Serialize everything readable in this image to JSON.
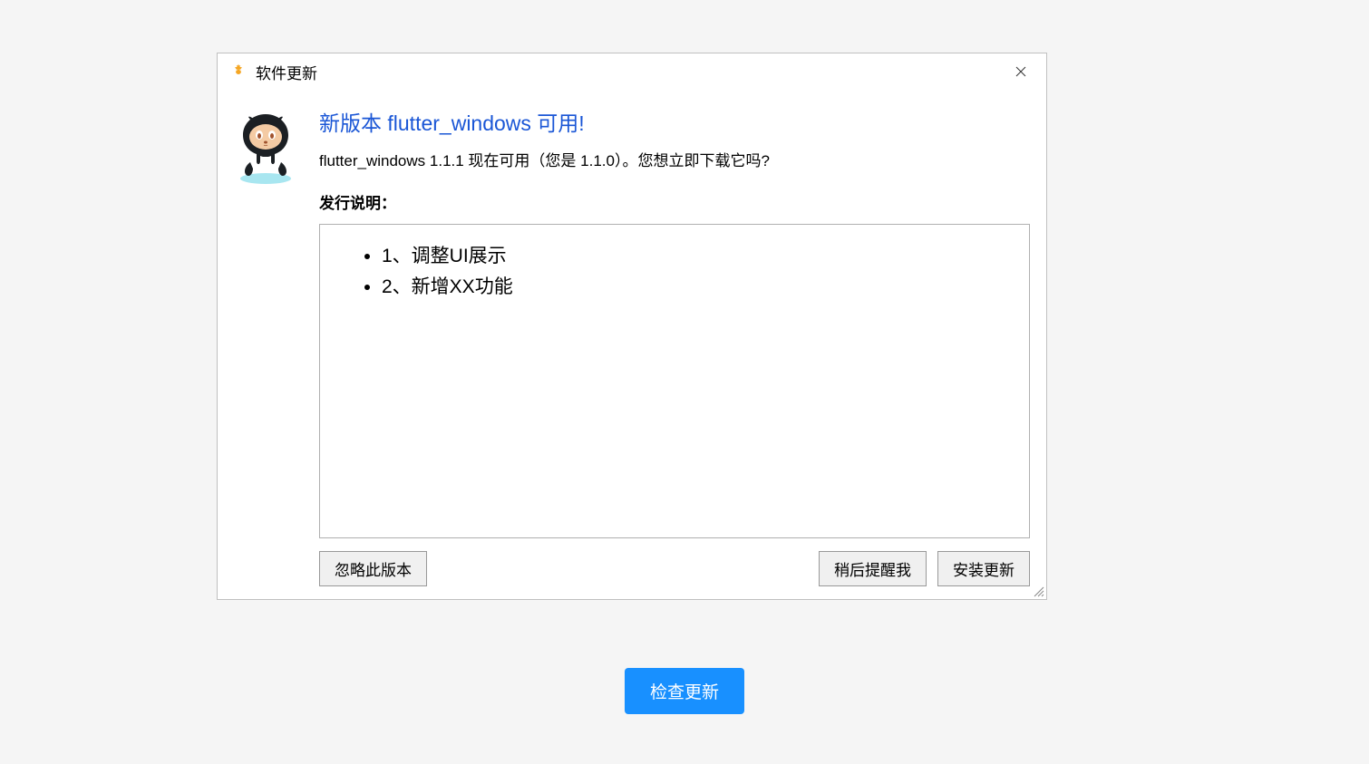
{
  "dialog": {
    "title": "软件更新",
    "heading": "新版本 flutter_windows 可用!",
    "subtext": "flutter_windows 1.1.1 现在可用（您是 1.1.0）。您想立即下载它吗?",
    "release_label": "发行说明：",
    "release_items": [
      "1、调整UI展示",
      "2、新增XX功能"
    ],
    "buttons": {
      "skip": "忽略此版本",
      "later": "稍后提醒我",
      "install": "安装更新"
    }
  },
  "page": {
    "check_update": "检查更新"
  }
}
